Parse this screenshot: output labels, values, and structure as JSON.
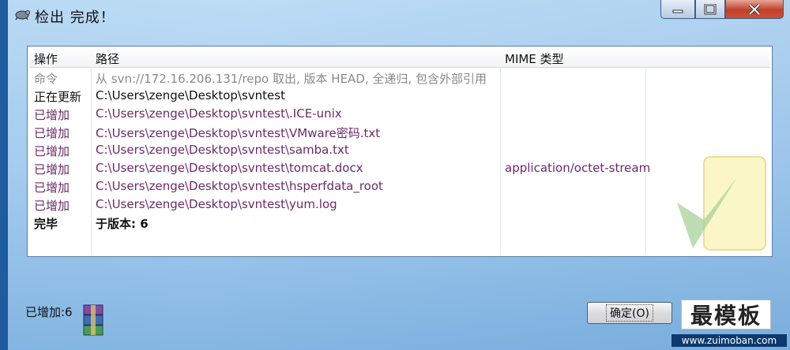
{
  "window": {
    "title": "检出 完成！"
  },
  "list": {
    "columns": [
      "操作",
      "路径",
      "MIME 类型"
    ],
    "rows": [
      {
        "action": "命令",
        "path": "从 svn://172.16.206.131/repo 取出, 版本 HEAD, 全递归, 包含外部引用",
        "mime": "",
        "style": "gray"
      },
      {
        "action": "正在更新",
        "path": "C:\\Users\\zenge\\Desktop\\svntest",
        "mime": "",
        "style": "black"
      },
      {
        "action": "已增加",
        "path": "C:\\Users\\zenge\\Desktop\\svntest\\.ICE-unix",
        "mime": "",
        "style": "purple"
      },
      {
        "action": "已增加",
        "path": "C:\\Users\\zenge\\Desktop\\svntest\\VMware密码.txt",
        "mime": "",
        "style": "purple"
      },
      {
        "action": "已增加",
        "path": "C:\\Users\\zenge\\Desktop\\svntest\\samba.txt",
        "mime": "",
        "style": "purple"
      },
      {
        "action": "已增加",
        "path": "C:\\Users\\zenge\\Desktop\\svntest\\tomcat.docx",
        "mime": "application/octet-stream",
        "style": "purple"
      },
      {
        "action": "已增加",
        "path": "C:\\Users\\zenge\\Desktop\\svntest\\hsperfdata_root",
        "mime": "",
        "style": "purple"
      },
      {
        "action": "已增加",
        "path": "C:\\Users\\zenge\\Desktop\\svntest\\yum.log",
        "mime": "",
        "style": "purple"
      },
      {
        "action": "完毕",
        "path": "于版本: 6",
        "mime": "",
        "style": "bold"
      }
    ]
  },
  "footer": {
    "status": "已增加:6",
    "ok_label": "确定(O)"
  },
  "branding": {
    "logo": "最模板",
    "url": "www.zuimoban.com"
  },
  "colors": {
    "added": "#6b2a67",
    "command": "#8a8a8a",
    "close_button": "#c0412a"
  }
}
